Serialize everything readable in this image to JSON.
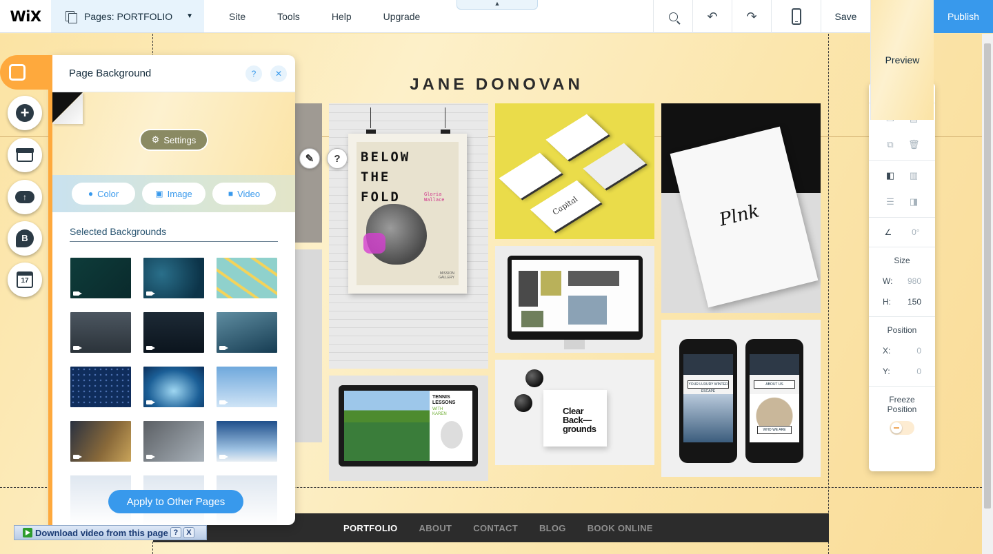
{
  "topbar": {
    "logo": "WiX",
    "pages_label": "Pages: PORTFOLIO",
    "menu": [
      "Site",
      "Tools",
      "Help",
      "Upgrade"
    ],
    "save_label": "Save",
    "preview_label": "Preview",
    "publish_label": "Publish",
    "accent_color": "#3899ec"
  },
  "site": {
    "title": "JANE DONOVAN",
    "nav": [
      "PORTFOLIO",
      "ABOUT",
      "CONTACT",
      "BLOG",
      "BOOK ONLINE"
    ],
    "active_nav": "PORTFOLIO",
    "poster_title": "BELOW\nTHE\nFOLD",
    "poster_sub": "Gloria Wallace",
    "poster_gallery": "MISSION\nGALLERY",
    "tennis_title": "TENNIS\nLESSONS",
    "tennis_sub": "WITH\nKAREN",
    "cd_text": "Clear\nBack—\ngrounds",
    "card_brand": "Capital",
    "stationery_sig": "Plnk",
    "phone1_label": "YOUR LUXURY WINTER ESCAPE",
    "phone2_label": "ABOUT US",
    "phone2_sub": "WHO WE ARE"
  },
  "left_rail": {
    "items": [
      "background-icon",
      "add-icon",
      "store-icon",
      "upload-icon",
      "blog-icon",
      "bookings-icon"
    ],
    "accent_color": "#fea93d",
    "calendar_day": "17",
    "blog_letter": "B"
  },
  "panel": {
    "title": "Page Background",
    "help": "?",
    "close": "✕",
    "settings_label": "Settings",
    "types": [
      {
        "label": "Color",
        "icon": "drop-icon"
      },
      {
        "label": "Image",
        "icon": "image-icon"
      },
      {
        "label": "Video",
        "icon": "video-icon"
      }
    ],
    "selected_label": "Selected Backgrounds",
    "apply_label": "Apply to Other Pages"
  },
  "tools": {
    "help": "?",
    "close": "✕",
    "rotation": "0°",
    "size_label": "Size",
    "w_label": "W:",
    "w_value": "980",
    "h_label": "H:",
    "h_value": "150",
    "position_label": "Position",
    "x_label": "X:",
    "x_value": "0",
    "y_label": "Y:",
    "y_value": "0",
    "freeze_label": "Freeze\nPosition"
  },
  "download_bar": {
    "label": "Download video from this page",
    "help": "?",
    "close": "X"
  }
}
